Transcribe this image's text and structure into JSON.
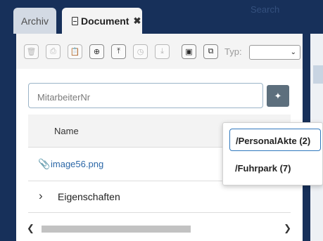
{
  "header": {
    "search_placeholder": "Search",
    "tabs": [
      {
        "label": "Archiv",
        "active": false
      },
      {
        "label": "Document",
        "active": true,
        "close_glyph": "✖",
        "icon": "document-icon"
      }
    ]
  },
  "toolbar": {
    "buttons": [
      {
        "name": "delete-button",
        "icon": "trash-icon",
        "glyph": "🗑",
        "enabled": false
      },
      {
        "name": "print-button",
        "icon": "print-icon",
        "glyph": "⎙",
        "enabled": false
      },
      {
        "name": "clipboard-button",
        "icon": "clipboard-icon",
        "glyph": "📋",
        "enabled": false
      },
      {
        "name": "add-button",
        "icon": "plus-circle-icon",
        "glyph": "⊕",
        "enabled": true
      },
      {
        "name": "upload-button",
        "icon": "upload-icon",
        "glyph": "⤒",
        "enabled": true
      },
      {
        "name": "history-button",
        "icon": "clock-icon",
        "glyph": "◷",
        "enabled": false
      },
      {
        "name": "download-button",
        "icon": "download-icon",
        "glyph": "⤓",
        "enabled": false
      },
      {
        "name": "save-button",
        "icon": "save-icon",
        "glyph": "▣",
        "enabled": true
      },
      {
        "name": "copy-button",
        "icon": "copy-icon",
        "glyph": "⧉",
        "enabled": true
      }
    ],
    "type_label": "Typ:",
    "type_value": ""
  },
  "search": {
    "placeholder": "MitarbeiterNr",
    "value": "",
    "wand_icon": "magic-wand-icon"
  },
  "table": {
    "header_name": "Name",
    "rows": [
      {
        "icon": "paperclip-icon",
        "name": "image56.png"
      }
    ]
  },
  "properties": {
    "label": "Eigenschaften",
    "chevron": "›"
  },
  "dropdown": {
    "items": [
      {
        "label": "/PersonalAkte (2)",
        "selected": true
      },
      {
        "label": "/Fuhrpark (7)",
        "selected": false
      }
    ]
  },
  "colors": {
    "header_bg": "#17305a",
    "link": "#2b67a7",
    "wand_btn": "#5d6f7d",
    "focus": "#2f77bd"
  }
}
